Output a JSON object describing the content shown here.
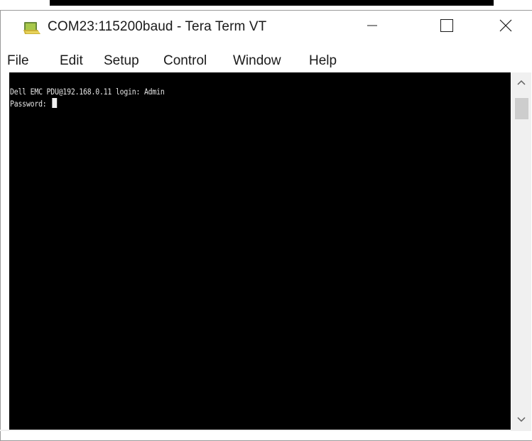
{
  "window": {
    "title": "COM23:115200baud - Tera Term VT",
    "app_icon": "tera-term-icon",
    "controls": {
      "minimize_icon": "minimize-icon",
      "maximize_icon": "maximize-icon",
      "close_icon": "close-icon"
    }
  },
  "menu": {
    "items": [
      "File",
      "Edit",
      "Setup",
      "Control",
      "Window",
      "Help"
    ]
  },
  "terminal": {
    "lines": [
      "Dell EMC PDU@192.168.0.11 login: Admin",
      "Password: "
    ],
    "background": "#000000",
    "foreground": "#e6e6e6"
  },
  "scrollbar": {
    "up_icon": "chevron-up-icon",
    "down_icon": "chevron-down-icon"
  }
}
